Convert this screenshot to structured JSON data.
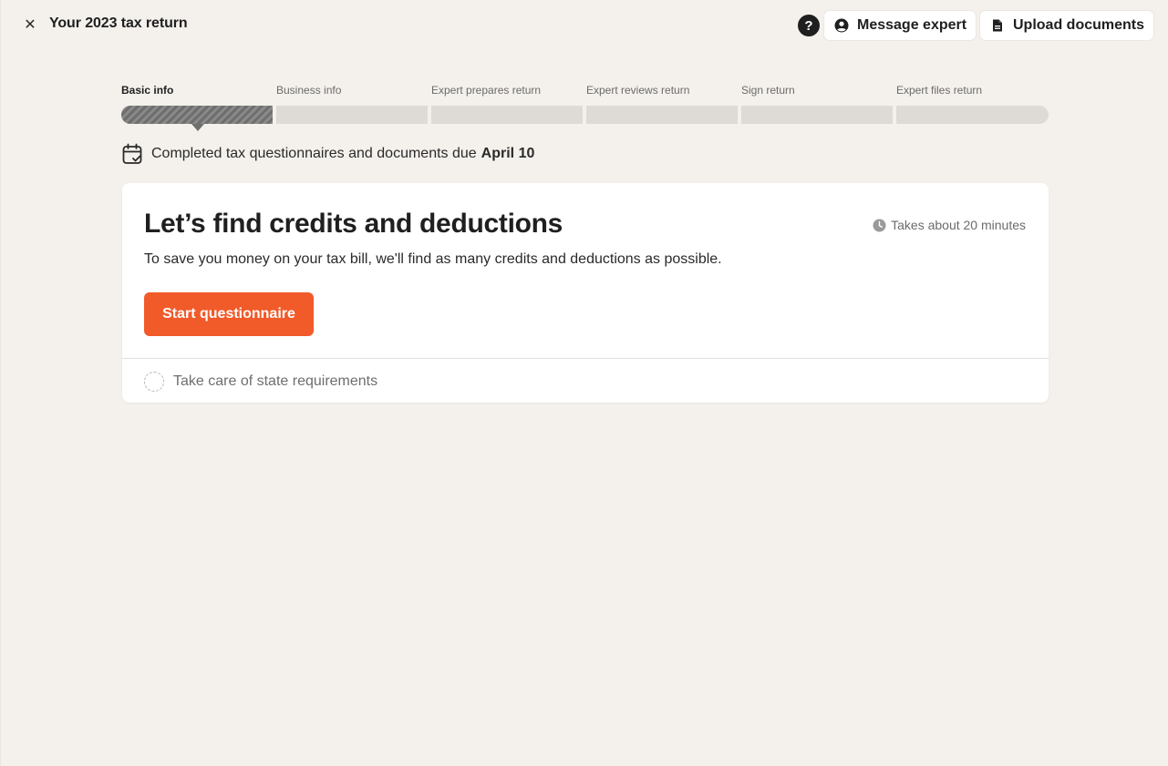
{
  "header": {
    "close_glyph": "✕",
    "title": "Your 2023 tax return",
    "help_glyph": "?",
    "message_expert_label": "Message expert",
    "upload_documents_label": "Upload documents"
  },
  "progress": {
    "steps": [
      {
        "label": "Basic info",
        "active": true
      },
      {
        "label": "Business info",
        "active": false
      },
      {
        "label": "Expert prepares return",
        "active": false
      },
      {
        "label": "Expert reviews return",
        "active": false
      },
      {
        "label": "Sign return",
        "active": false
      },
      {
        "label": "Expert files return",
        "active": false
      }
    ]
  },
  "due": {
    "text": "Completed tax questionnaires and documents due",
    "date": "April 10"
  },
  "card": {
    "title": "Let’s find credits and deductions",
    "duration": "Takes about 20 minutes",
    "description": "To save you money on your tax bill, we'll find as many credits and deductions as possible.",
    "cta_label": "Start questionnaire",
    "next_task": "Take care of state requirements"
  },
  "colors": {
    "background": "#f4f1ec",
    "accent": "#f15a29",
    "card": "#ffffff"
  },
  "icons": {
    "close": "close-icon",
    "help": "help-icon",
    "message": "user-circle-icon",
    "upload": "document-icon",
    "due": "calendar-check-icon",
    "duration": "clock-icon",
    "task": "dashed-circle-icon"
  }
}
